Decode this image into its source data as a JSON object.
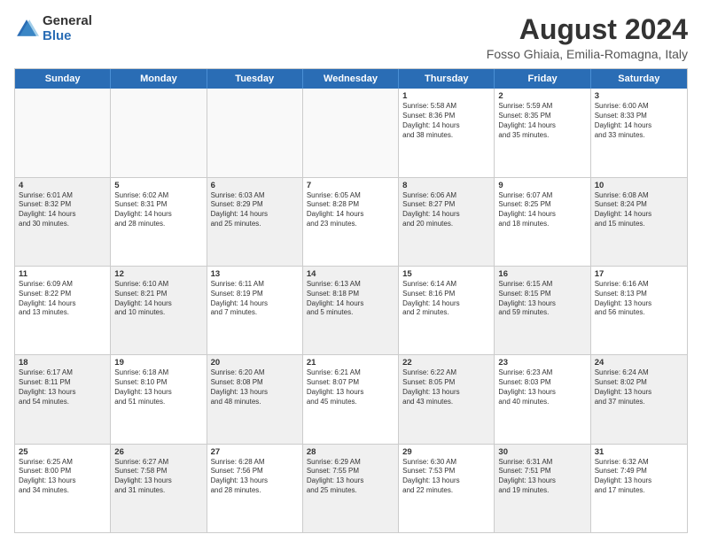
{
  "header": {
    "logo_line1": "General",
    "logo_line2": "Blue",
    "title": "August 2024",
    "subtitle": "Fosso Ghiaia, Emilia-Romagna, Italy"
  },
  "days": [
    "Sunday",
    "Monday",
    "Tuesday",
    "Wednesday",
    "Thursday",
    "Friday",
    "Saturday"
  ],
  "weeks": [
    [
      {
        "day": "",
        "text": "",
        "shaded": true
      },
      {
        "day": "",
        "text": "",
        "shaded": true
      },
      {
        "day": "",
        "text": "",
        "shaded": true
      },
      {
        "day": "",
        "text": "",
        "shaded": true
      },
      {
        "day": "1",
        "text": "Sunrise: 5:58 AM\nSunset: 8:36 PM\nDaylight: 14 hours\nand 38 minutes."
      },
      {
        "day": "2",
        "text": "Sunrise: 5:59 AM\nSunset: 8:35 PM\nDaylight: 14 hours\nand 35 minutes."
      },
      {
        "day": "3",
        "text": "Sunrise: 6:00 AM\nSunset: 8:33 PM\nDaylight: 14 hours\nand 33 minutes."
      }
    ],
    [
      {
        "day": "4",
        "text": "Sunrise: 6:01 AM\nSunset: 8:32 PM\nDaylight: 14 hours\nand 30 minutes.",
        "shaded": true
      },
      {
        "day": "5",
        "text": "Sunrise: 6:02 AM\nSunset: 8:31 PM\nDaylight: 14 hours\nand 28 minutes."
      },
      {
        "day": "6",
        "text": "Sunrise: 6:03 AM\nSunset: 8:29 PM\nDaylight: 14 hours\nand 25 minutes.",
        "shaded": true
      },
      {
        "day": "7",
        "text": "Sunrise: 6:05 AM\nSunset: 8:28 PM\nDaylight: 14 hours\nand 23 minutes."
      },
      {
        "day": "8",
        "text": "Sunrise: 6:06 AM\nSunset: 8:27 PM\nDaylight: 14 hours\nand 20 minutes.",
        "shaded": true
      },
      {
        "day": "9",
        "text": "Sunrise: 6:07 AM\nSunset: 8:25 PM\nDaylight: 14 hours\nand 18 minutes."
      },
      {
        "day": "10",
        "text": "Sunrise: 6:08 AM\nSunset: 8:24 PM\nDaylight: 14 hours\nand 15 minutes.",
        "shaded": true
      }
    ],
    [
      {
        "day": "11",
        "text": "Sunrise: 6:09 AM\nSunset: 8:22 PM\nDaylight: 14 hours\nand 13 minutes."
      },
      {
        "day": "12",
        "text": "Sunrise: 6:10 AM\nSunset: 8:21 PM\nDaylight: 14 hours\nand 10 minutes.",
        "shaded": true
      },
      {
        "day": "13",
        "text": "Sunrise: 6:11 AM\nSunset: 8:19 PM\nDaylight: 14 hours\nand 7 minutes."
      },
      {
        "day": "14",
        "text": "Sunrise: 6:13 AM\nSunset: 8:18 PM\nDaylight: 14 hours\nand 5 minutes.",
        "shaded": true
      },
      {
        "day": "15",
        "text": "Sunrise: 6:14 AM\nSunset: 8:16 PM\nDaylight: 14 hours\nand 2 minutes."
      },
      {
        "day": "16",
        "text": "Sunrise: 6:15 AM\nSunset: 8:15 PM\nDaylight: 13 hours\nand 59 minutes.",
        "shaded": true
      },
      {
        "day": "17",
        "text": "Sunrise: 6:16 AM\nSunset: 8:13 PM\nDaylight: 13 hours\nand 56 minutes."
      }
    ],
    [
      {
        "day": "18",
        "text": "Sunrise: 6:17 AM\nSunset: 8:11 PM\nDaylight: 13 hours\nand 54 minutes.",
        "shaded": true
      },
      {
        "day": "19",
        "text": "Sunrise: 6:18 AM\nSunset: 8:10 PM\nDaylight: 13 hours\nand 51 minutes."
      },
      {
        "day": "20",
        "text": "Sunrise: 6:20 AM\nSunset: 8:08 PM\nDaylight: 13 hours\nand 48 minutes.",
        "shaded": true
      },
      {
        "day": "21",
        "text": "Sunrise: 6:21 AM\nSunset: 8:07 PM\nDaylight: 13 hours\nand 45 minutes."
      },
      {
        "day": "22",
        "text": "Sunrise: 6:22 AM\nSunset: 8:05 PM\nDaylight: 13 hours\nand 43 minutes.",
        "shaded": true
      },
      {
        "day": "23",
        "text": "Sunrise: 6:23 AM\nSunset: 8:03 PM\nDaylight: 13 hours\nand 40 minutes."
      },
      {
        "day": "24",
        "text": "Sunrise: 6:24 AM\nSunset: 8:02 PM\nDaylight: 13 hours\nand 37 minutes.",
        "shaded": true
      }
    ],
    [
      {
        "day": "25",
        "text": "Sunrise: 6:25 AM\nSunset: 8:00 PM\nDaylight: 13 hours\nand 34 minutes."
      },
      {
        "day": "26",
        "text": "Sunrise: 6:27 AM\nSunset: 7:58 PM\nDaylight: 13 hours\nand 31 minutes.",
        "shaded": true
      },
      {
        "day": "27",
        "text": "Sunrise: 6:28 AM\nSunset: 7:56 PM\nDaylight: 13 hours\nand 28 minutes."
      },
      {
        "day": "28",
        "text": "Sunrise: 6:29 AM\nSunset: 7:55 PM\nDaylight: 13 hours\nand 25 minutes.",
        "shaded": true
      },
      {
        "day": "29",
        "text": "Sunrise: 6:30 AM\nSunset: 7:53 PM\nDaylight: 13 hours\nand 22 minutes."
      },
      {
        "day": "30",
        "text": "Sunrise: 6:31 AM\nSunset: 7:51 PM\nDaylight: 13 hours\nand 19 minutes.",
        "shaded": true
      },
      {
        "day": "31",
        "text": "Sunrise: 6:32 AM\nSunset: 7:49 PM\nDaylight: 13 hours\nand 17 minutes."
      }
    ]
  ]
}
